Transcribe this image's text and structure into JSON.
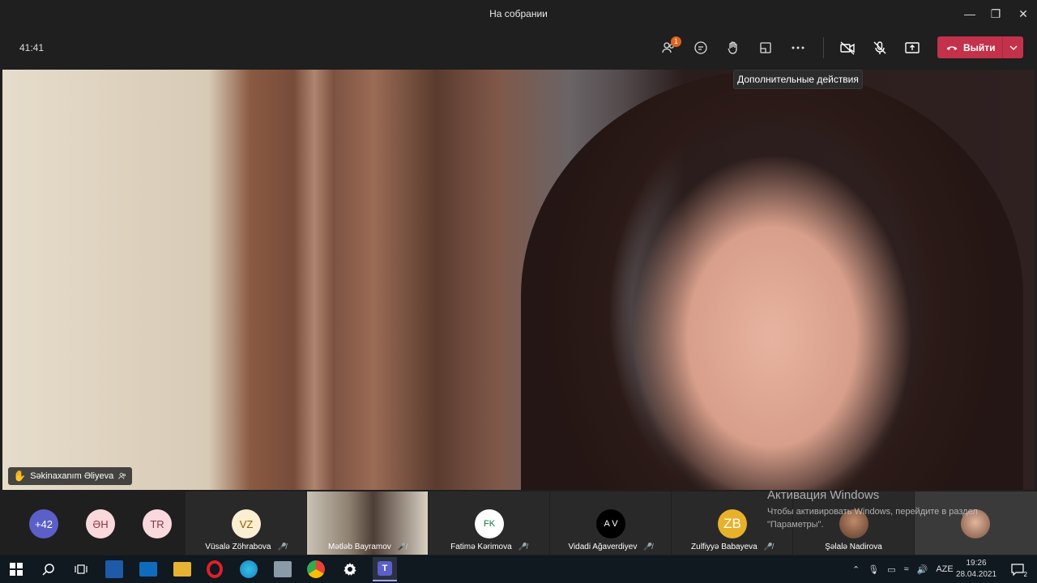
{
  "window": {
    "title": "На собрании"
  },
  "toolbar": {
    "timer": "41:41",
    "participants_badge": "1",
    "leave_label": "Выйти",
    "tooltip": "Дополнительные действия"
  },
  "main_video": {
    "participant": "Səkinaxanım Əliyeva"
  },
  "strip": {
    "overflow": "+42",
    "avatars": [
      {
        "initials": "ƏH",
        "bg": "#f9d9dc",
        "fg": "#92333d"
      },
      {
        "initials": "TR",
        "bg": "#f9d9dc",
        "fg": "#8a3344"
      }
    ],
    "tiles": [
      {
        "initials": "VZ",
        "name": "Vüsalə Zöhrabova",
        "bg": "#fbeed1",
        "fg": "#8f6200"
      },
      {
        "initials": "",
        "name": "Mətləb Bayramov",
        "bg": "",
        "fg": ""
      },
      {
        "initials": "FK",
        "name": "Fatimə Kərimova",
        "bg": "#ffffff",
        "fg": "#107c41"
      },
      {
        "initials": "A V",
        "name": "Vidadi Ağaverdiyev",
        "bg": "#000000",
        "fg": "#ffffff"
      },
      {
        "initials": "ZB",
        "name": "Zulfiyyə Babayeva",
        "bg": "#e7b229",
        "fg": "#ffffff"
      },
      {
        "initials": "",
        "name": "Şəlalə Nadirova",
        "bg": "",
        "fg": ""
      }
    ]
  },
  "activation": {
    "title": "Активация Windows",
    "text": "Чтобы активировать Windows, перейдите в раздел \"Параметры\"."
  },
  "taskbar": {
    "lang": "AZE",
    "time": "19:26",
    "date": "28.04.2021",
    "notifications": "2"
  }
}
